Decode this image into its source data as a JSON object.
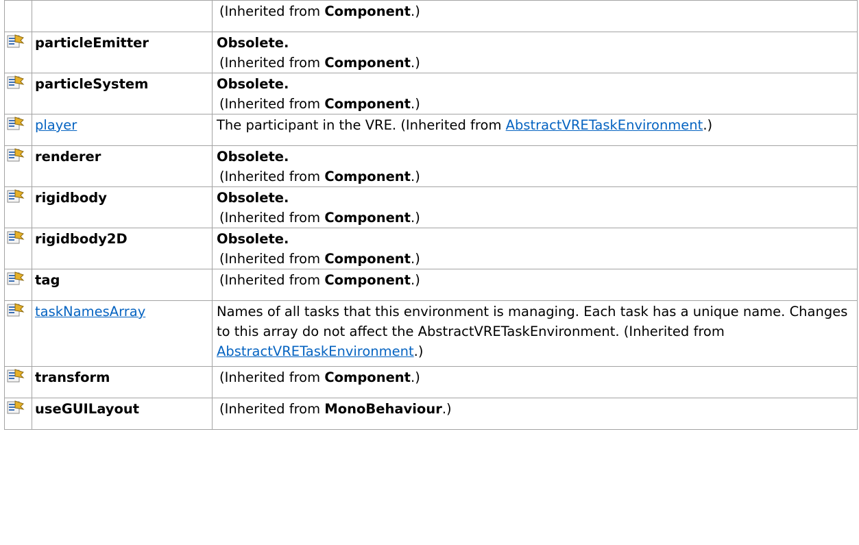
{
  "colors": {
    "link": "#0563c1",
    "border": "#a3a3a3",
    "icon_gold": "#e6b12a",
    "icon_blue": "#3a6fb5"
  },
  "rows": [
    {
      "name": "",
      "link": false,
      "obsolete": false,
      "desc": "",
      "inherit_prefix": "(Inherited from ",
      "inherit_from": "Component",
      "inherit_suffix": ".)",
      "inherit_link": false
    },
    {
      "name": "particleEmitter",
      "link": false,
      "obsolete": true,
      "obsolete_label": "Obsolete.",
      "desc": "",
      "inherit_prefix": "(Inherited from ",
      "inherit_from": "Component",
      "inherit_suffix": ".)",
      "inherit_link": false
    },
    {
      "name": "particleSystem",
      "link": false,
      "obsolete": true,
      "obsolete_label": "Obsolete.",
      "desc": "",
      "inherit_prefix": "(Inherited from ",
      "inherit_from": "Component",
      "inherit_suffix": ".)",
      "inherit_link": false
    },
    {
      "name": "player",
      "link": true,
      "obsolete": false,
      "desc": "The participant in the VRE. ",
      "inherit_prefix": "(Inherited from ",
      "inherit_from": "AbstractVRETaskEnvironment",
      "inherit_suffix": ".)",
      "inherit_link": true
    },
    {
      "name": "renderer",
      "link": false,
      "obsolete": true,
      "obsolete_label": "Obsolete.",
      "desc": "",
      "inherit_prefix": "(Inherited from ",
      "inherit_from": "Component",
      "inherit_suffix": ".)",
      "inherit_link": false
    },
    {
      "name": "rigidbody",
      "link": false,
      "obsolete": true,
      "obsolete_label": "Obsolete.",
      "desc": "",
      "inherit_prefix": "(Inherited from ",
      "inherit_from": "Component",
      "inherit_suffix": ".)",
      "inherit_link": false
    },
    {
      "name": "rigidbody2D",
      "link": false,
      "obsolete": true,
      "obsolete_label": "Obsolete.",
      "desc": "",
      "inherit_prefix": "(Inherited from ",
      "inherit_from": "Component",
      "inherit_suffix": ".)",
      "inherit_link": false
    },
    {
      "name": "tag",
      "link": false,
      "obsolete": false,
      "desc": "",
      "inherit_prefix": "(Inherited from ",
      "inherit_from": "Component",
      "inherit_suffix": ".)",
      "inherit_link": false
    },
    {
      "name": "taskNamesArray",
      "link": true,
      "obsolete": false,
      "desc": "Names of all tasks that this environment is managing. Each task has a unique name. Changes to this array do not affect the AbstractVRETaskEnvironment. ",
      "inherit_prefix": "(Inherited from ",
      "inherit_from": "AbstractVRETaskEnvironment",
      "inherit_suffix": ".)",
      "inherit_link": true
    },
    {
      "name": "transform",
      "link": false,
      "obsolete": false,
      "desc": "",
      "inherit_prefix": "(Inherited from ",
      "inherit_from": "Component",
      "inherit_suffix": ".)",
      "inherit_link": false
    },
    {
      "name": "useGUILayout",
      "link": false,
      "obsolete": false,
      "desc": "",
      "inherit_prefix": "(Inherited from ",
      "inherit_from": "MonoBehaviour",
      "inherit_suffix": ".)",
      "inherit_link": false
    }
  ]
}
